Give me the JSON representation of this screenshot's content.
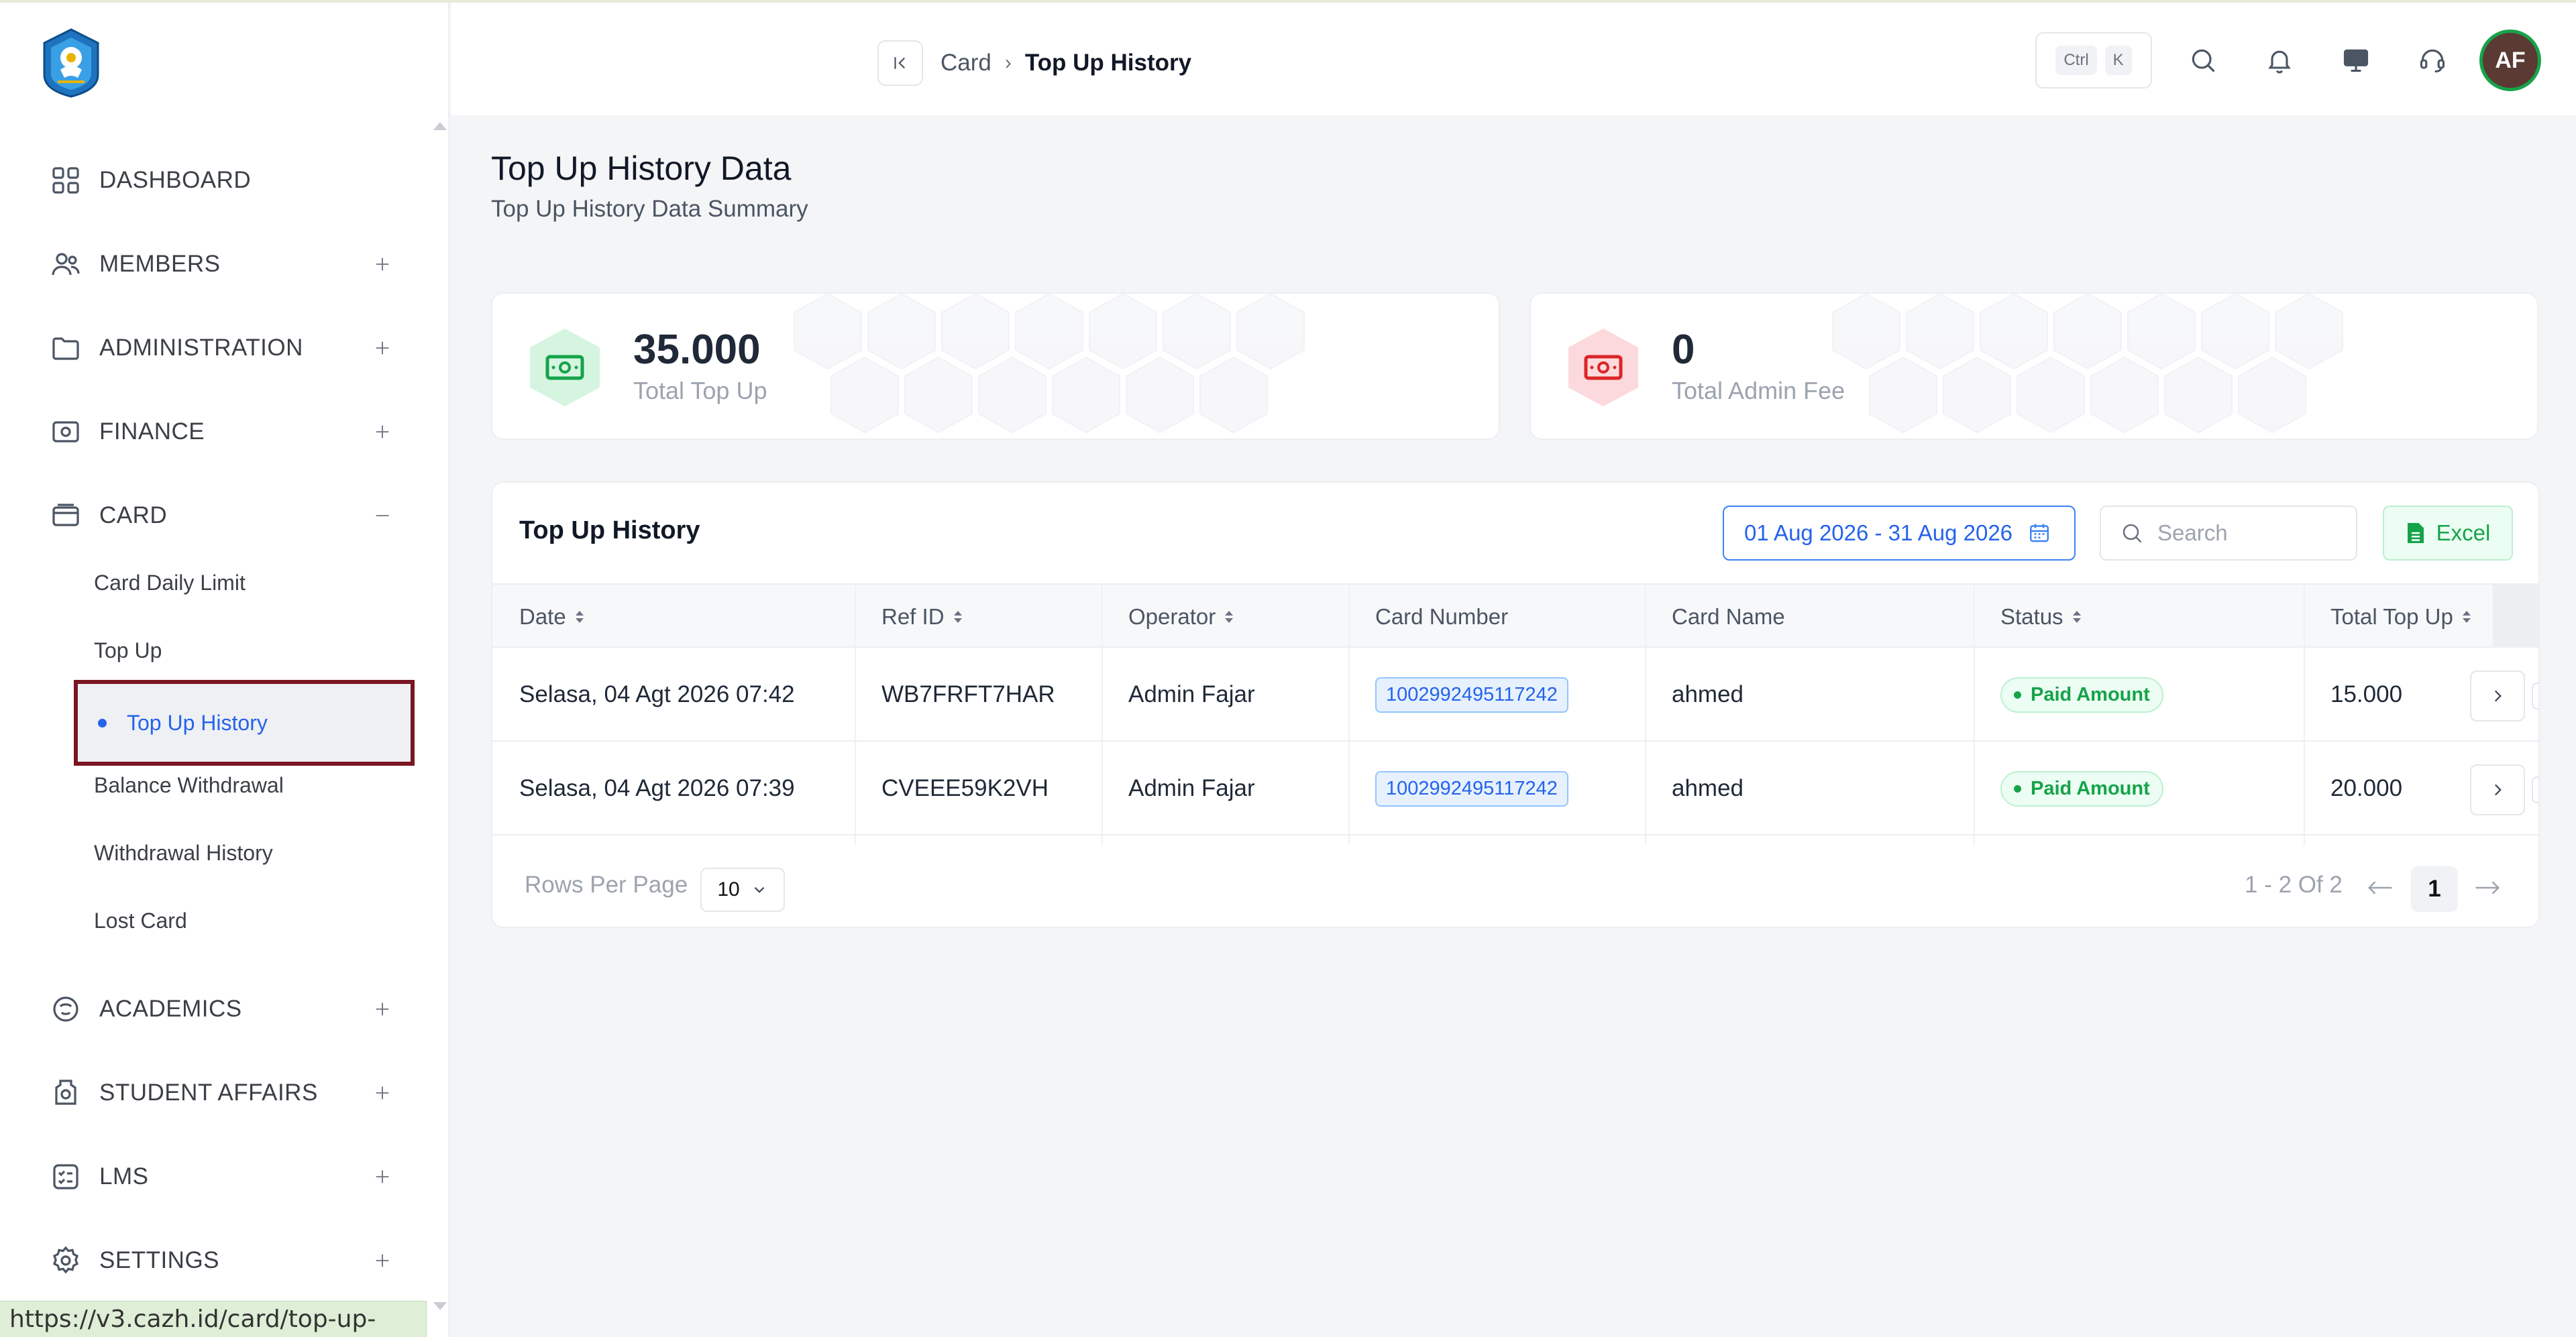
{
  "status_url": "https://v3.cazh.id/card/top-up-history",
  "sidebar": {
    "items": [
      {
        "key": "dashboard",
        "label": "DASHBOARD",
        "icon": "grid-icon",
        "toggle": "none"
      },
      {
        "key": "members",
        "label": "MEMBERS",
        "icon": "users-icon",
        "toggle": "plus"
      },
      {
        "key": "administration",
        "label": "ADMINISTRATION",
        "icon": "folder-icon",
        "toggle": "plus"
      },
      {
        "key": "finance",
        "label": "FINANCE",
        "icon": "money-icon",
        "toggle": "plus"
      },
      {
        "key": "card",
        "label": "CARD",
        "icon": "card-icon",
        "toggle": "minus"
      },
      {
        "key": "academics",
        "label": "ACADEMICS",
        "icon": "academic-icon",
        "toggle": "plus"
      },
      {
        "key": "student-affairs",
        "label": "STUDENT AFFAIRS",
        "icon": "badge-icon",
        "toggle": "plus"
      },
      {
        "key": "lms",
        "label": "LMS",
        "icon": "checklist-icon",
        "toggle": "plus"
      },
      {
        "key": "settings",
        "label": "SETTINGS",
        "icon": "gear-icon",
        "toggle": "plus"
      }
    ],
    "card_sub": [
      "Card Daily Limit",
      "Top Up",
      "Top Up History",
      "Balance Withdrawal",
      "Withdrawal History",
      "Lost Card"
    ]
  },
  "header": {
    "breadcrumb": [
      "Card",
      "Top Up History"
    ],
    "kbd": [
      "Ctrl",
      "K"
    ],
    "avatar": "AF"
  },
  "page": {
    "title": "Top Up History Data",
    "subtitle": "Top Up History Data Summary"
  },
  "stats": [
    {
      "value": "35.000",
      "caption": "Total Top Up",
      "color": "#16a34a"
    },
    {
      "value": "0",
      "caption": "Total Admin Fee",
      "color": "#dc2626"
    }
  ],
  "table": {
    "title": "Top Up History",
    "date_range": "01 Aug 2026 - 31 Aug 2026",
    "search_placeholder": "Search",
    "excel_label": "Excel",
    "columns": [
      "Date",
      "Ref ID",
      "Operator",
      "Card Number",
      "Card Name",
      "Status",
      "Total Top Up"
    ],
    "rows": [
      {
        "date": "Selasa, 04 Agt 2026 07:42",
        "ref": "WB7FRFT7HAR",
        "operator": "Admin Fajar",
        "card_number": "1002992495117242",
        "card_name": "ahmed",
        "status": "Paid Amount",
        "total": "15.000"
      },
      {
        "date": "Selasa, 04 Agt 2026 07:39",
        "ref": "CVEEE59K2VH",
        "operator": "Admin Fajar",
        "card_number": "1002992495117242",
        "card_name": "ahmed",
        "status": "Paid Amount",
        "total": "20.000"
      }
    ],
    "rows_per_page_label": "Rows Per Page",
    "rows_per_page": "10",
    "pagination_info": "1 - 2 Of 2",
    "current_page": "1"
  },
  "colors": {
    "accent": "#2563eb",
    "highlight_border": "#7a1522",
    "success": "#16a34a",
    "danger": "#dc2626"
  }
}
